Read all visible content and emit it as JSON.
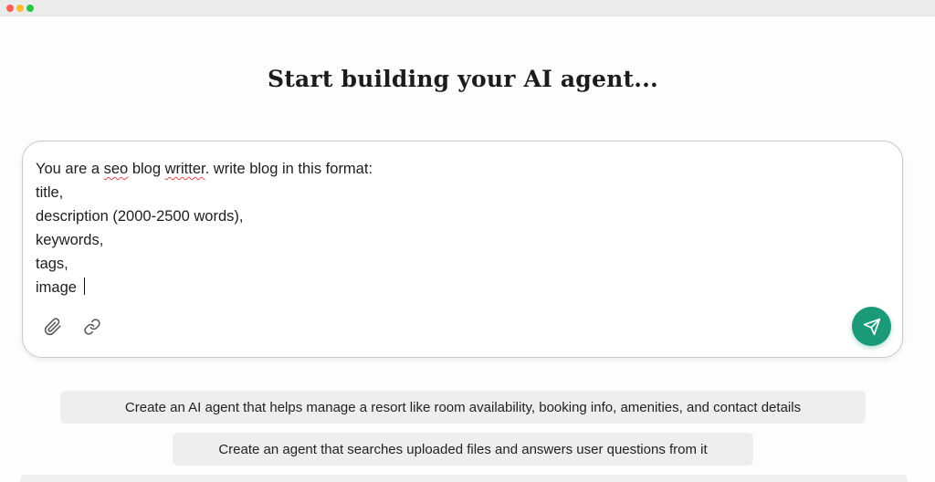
{
  "window": {
    "controls": [
      "close",
      "minimize",
      "maximize"
    ]
  },
  "page": {
    "title": "Start building your AI agent..."
  },
  "composer": {
    "lines": [
      {
        "pre": "You are a ",
        "misspelled1": "seo",
        "mid": " blog ",
        "misspelled2": "writter",
        "post": ". write blog in this format:"
      },
      "title,",
      "description (2000-2500 words),",
      "keywords,",
      "tags,",
      "image "
    ],
    "tools": {
      "attach_icon": "paperclip-icon",
      "link_icon": "link-icon"
    },
    "send_icon": "send-icon",
    "accent_color": "#1a9a78"
  },
  "suggestions": [
    "Create an AI agent that helps manage a resort like room availability, booking info, amenities, and contact details",
    "Create an agent that searches uploaded files and answers user questions from it"
  ]
}
